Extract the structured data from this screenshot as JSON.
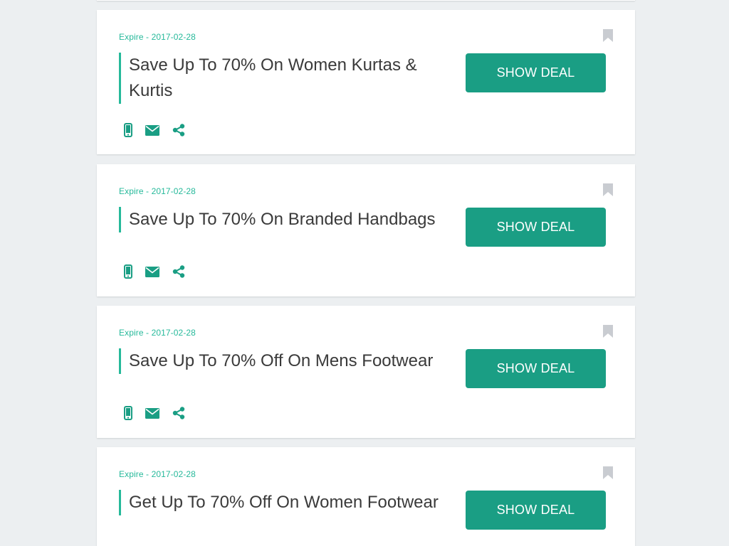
{
  "colors": {
    "accent": "#1a9e84",
    "expire_text": "#26b99a",
    "title_text": "#3a3a3a",
    "bookmark": "#c9ccd1",
    "background": "#eceff1"
  },
  "icons": {
    "mobile": "mobile-icon",
    "email": "envelope-icon",
    "share": "share-icon",
    "bookmark": "bookmark-icon"
  },
  "deals": [
    {
      "expire": "Expire - 2017-02-28",
      "title": "Save Up To 70% On Women Kurtas & Kurtis",
      "button": "SHOW DEAL"
    },
    {
      "expire": "Expire - 2017-02-28",
      "title": "Save Up To 70% On Branded Handbags",
      "button": "SHOW DEAL"
    },
    {
      "expire": "Expire - 2017-02-28",
      "title": "Save Up To 70% Off On Mens Footwear",
      "button": "SHOW DEAL"
    },
    {
      "expire": "Expire - 2017-02-28",
      "title": "Get Up To 70% Off On Women Footwear",
      "button": "SHOW DEAL"
    }
  ]
}
